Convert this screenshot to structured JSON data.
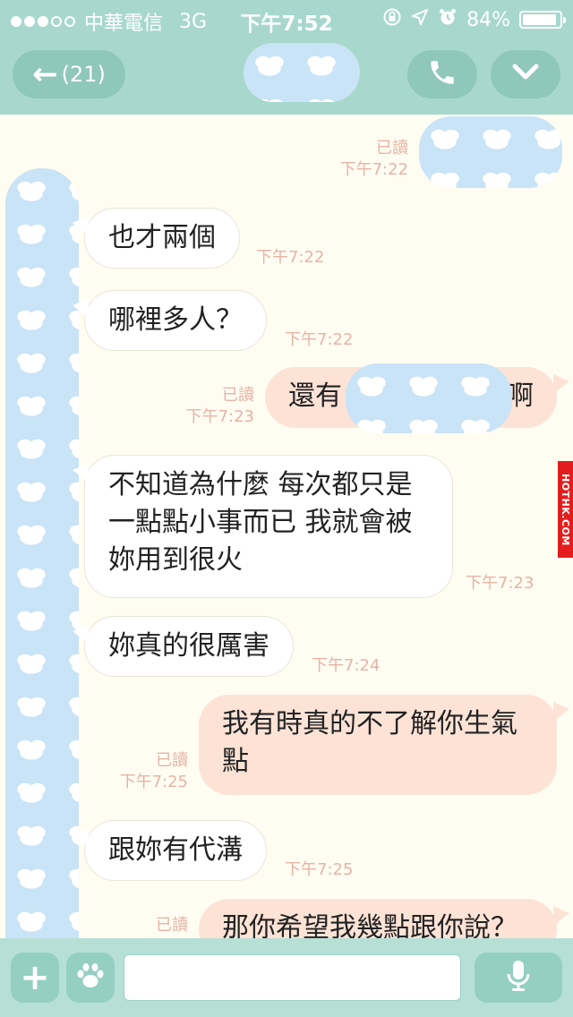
{
  "status_bar": {
    "carrier": "中華電信",
    "network": "3G",
    "time": "下午7:52",
    "battery": "84%",
    "battery_level": 0.84
  },
  "header": {
    "back_count": "(21)",
    "back_icon": "arrow-left-icon",
    "call_icon": "phone-icon",
    "menu_icon": "chevron-down-icon"
  },
  "messages": [
    {
      "side": "out",
      "text": "",
      "read": "已讀",
      "time": "下午7:22"
    },
    {
      "side": "in",
      "text": "也才兩個",
      "time": "下午7:22"
    },
    {
      "side": "in",
      "text": "哪裡多人？",
      "time": "下午7:22"
    },
    {
      "side": "out",
      "text_before": "還有",
      "text_after": "啊",
      "read": "已讀",
      "time": "下午7:23"
    },
    {
      "side": "in",
      "text": "不知道為什麼 每次都只是一點點小事而已 我就會被妳用到很火",
      "time": "下午7:23"
    },
    {
      "side": "in",
      "text": "妳真的很厲害",
      "time": "下午7:24"
    },
    {
      "side": "out",
      "text": "我有時真的不了解你生氣點",
      "read": "已讀",
      "time": "下午7:25"
    },
    {
      "side": "in",
      "text": "跟妳有代溝",
      "time": "下午7:25"
    },
    {
      "side": "out",
      "text": "那你希望我幾點跟你說？",
      "read": "已讀",
      "time": ""
    }
  ],
  "watermark": "HOTHK.COM",
  "input": {
    "plus_label": "+",
    "value": "",
    "placeholder": ""
  },
  "colors": {
    "header": "#a8d8cd",
    "button": "#8fc7ba",
    "background": "#fffdf2",
    "incoming_bubble": "#ffffff",
    "outgoing_bubble": "#fde3d6",
    "meta_text": "#e7b3a6"
  }
}
